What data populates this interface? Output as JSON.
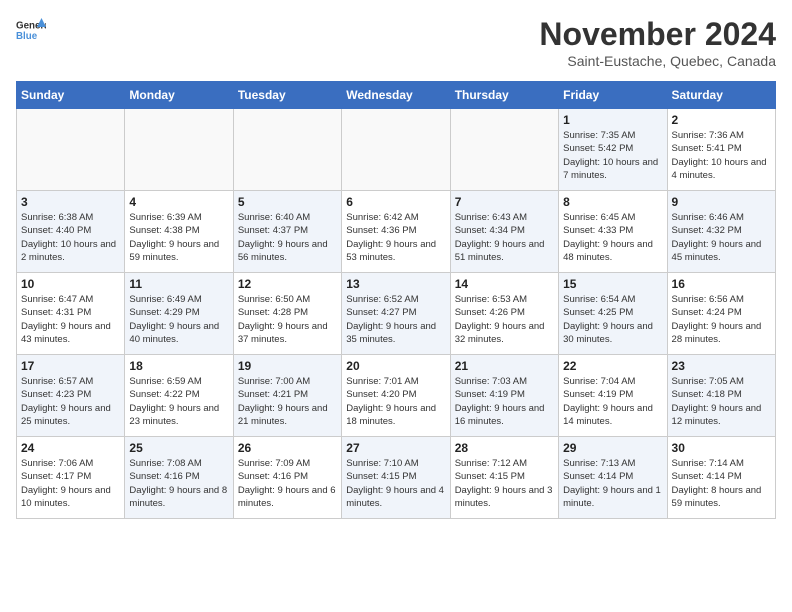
{
  "logo": {
    "text_general": "General",
    "text_blue": "Blue"
  },
  "header": {
    "month_title": "November 2024",
    "subtitle": "Saint-Eustache, Quebec, Canada"
  },
  "weekdays": [
    "Sunday",
    "Monday",
    "Tuesday",
    "Wednesday",
    "Thursday",
    "Friday",
    "Saturday"
  ],
  "weeks": [
    [
      {
        "day": "",
        "info": "",
        "empty": true
      },
      {
        "day": "",
        "info": "",
        "empty": true
      },
      {
        "day": "",
        "info": "",
        "empty": true
      },
      {
        "day": "",
        "info": "",
        "empty": true
      },
      {
        "day": "",
        "info": "",
        "empty": true
      },
      {
        "day": "1",
        "info": "Sunrise: 7:35 AM\nSunset: 5:42 PM\nDaylight: 10 hours and 7 minutes.",
        "shaded": true
      },
      {
        "day": "2",
        "info": "Sunrise: 7:36 AM\nSunset: 5:41 PM\nDaylight: 10 hours and 4 minutes.",
        "shaded": false
      }
    ],
    [
      {
        "day": "3",
        "info": "Sunrise: 6:38 AM\nSunset: 4:40 PM\nDaylight: 10 hours and 2 minutes.",
        "shaded": true
      },
      {
        "day": "4",
        "info": "Sunrise: 6:39 AM\nSunset: 4:38 PM\nDaylight: 9 hours and 59 minutes.",
        "shaded": false
      },
      {
        "day": "5",
        "info": "Sunrise: 6:40 AM\nSunset: 4:37 PM\nDaylight: 9 hours and 56 minutes.",
        "shaded": true
      },
      {
        "day": "6",
        "info": "Sunrise: 6:42 AM\nSunset: 4:36 PM\nDaylight: 9 hours and 53 minutes.",
        "shaded": false
      },
      {
        "day": "7",
        "info": "Sunrise: 6:43 AM\nSunset: 4:34 PM\nDaylight: 9 hours and 51 minutes.",
        "shaded": true
      },
      {
        "day": "8",
        "info": "Sunrise: 6:45 AM\nSunset: 4:33 PM\nDaylight: 9 hours and 48 minutes.",
        "shaded": false
      },
      {
        "day": "9",
        "info": "Sunrise: 6:46 AM\nSunset: 4:32 PM\nDaylight: 9 hours and 45 minutes.",
        "shaded": true
      }
    ],
    [
      {
        "day": "10",
        "info": "Sunrise: 6:47 AM\nSunset: 4:31 PM\nDaylight: 9 hours and 43 minutes.",
        "shaded": false
      },
      {
        "day": "11",
        "info": "Sunrise: 6:49 AM\nSunset: 4:29 PM\nDaylight: 9 hours and 40 minutes.",
        "shaded": true
      },
      {
        "day": "12",
        "info": "Sunrise: 6:50 AM\nSunset: 4:28 PM\nDaylight: 9 hours and 37 minutes.",
        "shaded": false
      },
      {
        "day": "13",
        "info": "Sunrise: 6:52 AM\nSunset: 4:27 PM\nDaylight: 9 hours and 35 minutes.",
        "shaded": true
      },
      {
        "day": "14",
        "info": "Sunrise: 6:53 AM\nSunset: 4:26 PM\nDaylight: 9 hours and 32 minutes.",
        "shaded": false
      },
      {
        "day": "15",
        "info": "Sunrise: 6:54 AM\nSunset: 4:25 PM\nDaylight: 9 hours and 30 minutes.",
        "shaded": true
      },
      {
        "day": "16",
        "info": "Sunrise: 6:56 AM\nSunset: 4:24 PM\nDaylight: 9 hours and 28 minutes.",
        "shaded": false
      }
    ],
    [
      {
        "day": "17",
        "info": "Sunrise: 6:57 AM\nSunset: 4:23 PM\nDaylight: 9 hours and 25 minutes.",
        "shaded": true
      },
      {
        "day": "18",
        "info": "Sunrise: 6:59 AM\nSunset: 4:22 PM\nDaylight: 9 hours and 23 minutes.",
        "shaded": false
      },
      {
        "day": "19",
        "info": "Sunrise: 7:00 AM\nSunset: 4:21 PM\nDaylight: 9 hours and 21 minutes.",
        "shaded": true
      },
      {
        "day": "20",
        "info": "Sunrise: 7:01 AM\nSunset: 4:20 PM\nDaylight: 9 hours and 18 minutes.",
        "shaded": false
      },
      {
        "day": "21",
        "info": "Sunrise: 7:03 AM\nSunset: 4:19 PM\nDaylight: 9 hours and 16 minutes.",
        "shaded": true
      },
      {
        "day": "22",
        "info": "Sunrise: 7:04 AM\nSunset: 4:19 PM\nDaylight: 9 hours and 14 minutes.",
        "shaded": false
      },
      {
        "day": "23",
        "info": "Sunrise: 7:05 AM\nSunset: 4:18 PM\nDaylight: 9 hours and 12 minutes.",
        "shaded": true
      }
    ],
    [
      {
        "day": "24",
        "info": "Sunrise: 7:06 AM\nSunset: 4:17 PM\nDaylight: 9 hours and 10 minutes.",
        "shaded": false
      },
      {
        "day": "25",
        "info": "Sunrise: 7:08 AM\nSunset: 4:16 PM\nDaylight: 9 hours and 8 minutes.",
        "shaded": true
      },
      {
        "day": "26",
        "info": "Sunrise: 7:09 AM\nSunset: 4:16 PM\nDaylight: 9 hours and 6 minutes.",
        "shaded": false
      },
      {
        "day": "27",
        "info": "Sunrise: 7:10 AM\nSunset: 4:15 PM\nDaylight: 9 hours and 4 minutes.",
        "shaded": true
      },
      {
        "day": "28",
        "info": "Sunrise: 7:12 AM\nSunset: 4:15 PM\nDaylight: 9 hours and 3 minutes.",
        "shaded": false
      },
      {
        "day": "29",
        "info": "Sunrise: 7:13 AM\nSunset: 4:14 PM\nDaylight: 9 hours and 1 minute.",
        "shaded": true
      },
      {
        "day": "30",
        "info": "Sunrise: 7:14 AM\nSunset: 4:14 PM\nDaylight: 8 hours and 59 minutes.",
        "shaded": false
      }
    ]
  ]
}
